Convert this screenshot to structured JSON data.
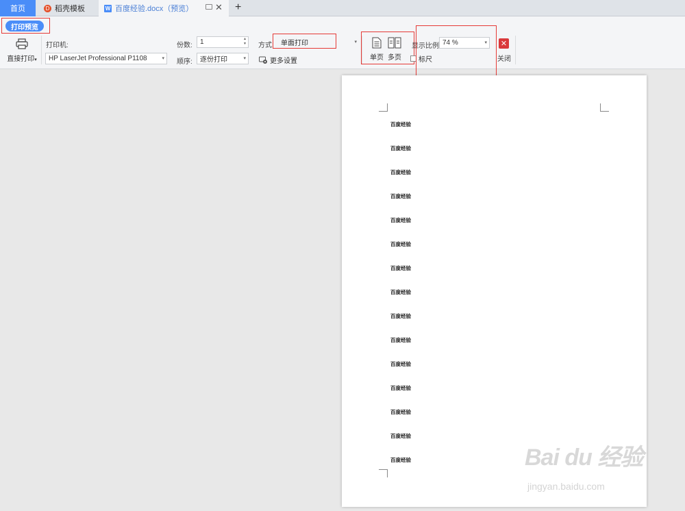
{
  "tabs": {
    "home": "首页",
    "template": "稻壳模板",
    "template_icon": "D",
    "document": "百度经验.docx（预览）",
    "document_icon": "W",
    "close_glyph": "✕",
    "add_glyph": "+"
  },
  "toolbar": {
    "preview_label": "打印预览",
    "direct_print_label": "直接打印",
    "direct_print_caret": "▾",
    "printer_label": "打印机:",
    "printer_value": "HP LaserJet Professional P1108",
    "copies_label": "份数:",
    "copies_value": "1",
    "order_label": "顺序:",
    "order_value": "逐份打印",
    "mode_label": "方式:",
    "mode_value": "单面打印",
    "more_settings": "更多设置",
    "single_page": "单页",
    "multi_page": "多页",
    "zoom_label": "显示比例",
    "zoom_value": "74 %",
    "ruler_label": "标尺",
    "close_label": "关闭",
    "close_glyph": "✕",
    "dropdown_glyph": "▾"
  },
  "document": {
    "lines": [
      "百度经验",
      "百度经验",
      "百度经验",
      "百度经验",
      "百度经验",
      "百度经验",
      "百度经验",
      "百度经验",
      "百度经验",
      "百度经验",
      "百度经验",
      "百度经验",
      "百度经验",
      "百度经验",
      "百度经验"
    ]
  },
  "watermark": {
    "brand": "Bai du 经验",
    "url": "jingyan.baidu.com"
  },
  "colors": {
    "accent": "#4a8df8",
    "highlight_box": "#e53935",
    "close_red": "#d9393b"
  }
}
